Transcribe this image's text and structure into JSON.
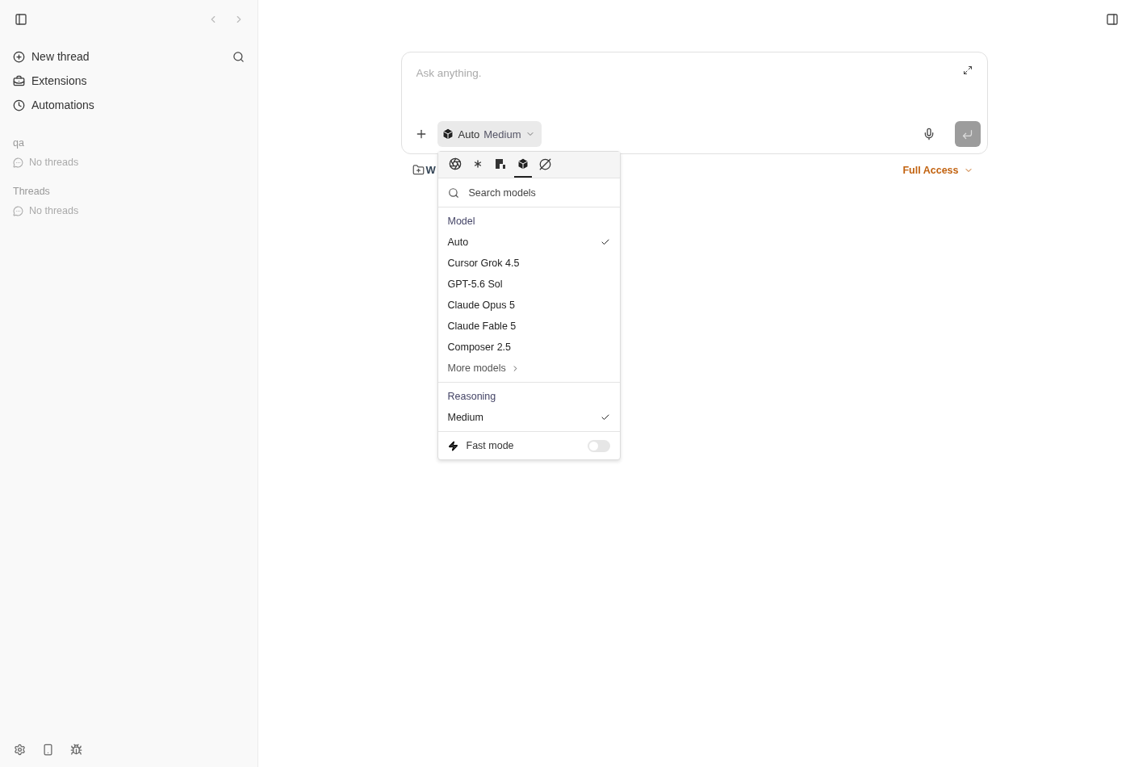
{
  "sidebar": {
    "nav": [
      {
        "kind": "new",
        "label": "New thread"
      },
      {
        "kind": "extensions",
        "label": "Extensions"
      },
      {
        "kind": "automations",
        "label": "Automations"
      }
    ],
    "sections": [
      {
        "title": "qa",
        "empty": "No threads"
      },
      {
        "title": "Threads",
        "empty": "No threads"
      }
    ]
  },
  "composer": {
    "placeholder": "Ask anything.",
    "model_button": {
      "model": "Auto",
      "reasoning": "Medium"
    },
    "workspace": "W",
    "access": "Full Access"
  },
  "model_menu": {
    "provider_tabs": [
      {
        "kind": "spiral",
        "selected": false
      },
      {
        "kind": "asterisk",
        "selected": false
      },
      {
        "kind": "blocks",
        "selected": false
      },
      {
        "kind": "cube",
        "selected": true
      },
      {
        "kind": "slashed",
        "selected": false
      }
    ],
    "search_placeholder": "Search models",
    "model_heading": "Model",
    "models": [
      {
        "label": "Auto",
        "selected": true
      },
      {
        "label": "Cursor Grok 4.5",
        "selected": false
      },
      {
        "label": "GPT-5.6 Sol",
        "selected": false
      },
      {
        "label": "Claude Opus 5",
        "selected": false
      },
      {
        "label": "Claude Fable 5",
        "selected": false
      },
      {
        "label": "Composer 2.5",
        "selected": false
      }
    ],
    "more": "More models",
    "reasoning_heading": "Reasoning",
    "reasoning": [
      {
        "label": "Medium",
        "selected": true
      }
    ],
    "fast_mode": {
      "label": "Fast mode",
      "on": false
    }
  }
}
